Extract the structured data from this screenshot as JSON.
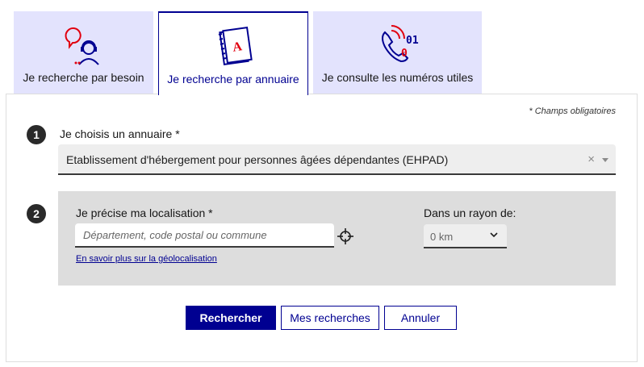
{
  "tabs": [
    {
      "label": "Je recherche par besoin",
      "icon": "person-speech-icon"
    },
    {
      "label": "Je recherche par annuaire",
      "icon": "address-book-icon"
    },
    {
      "label": "Je consulte les numéros utiles",
      "icon": "phone-numbers-icon"
    }
  ],
  "active_tab": 1,
  "form": {
    "required_note": "* Champs obligatoires",
    "step1": {
      "number": "1",
      "label": "Je choisis un annuaire *",
      "selected_value": "Etablissement d'hébergement pour personnes âgées dépendantes (EHPAD)",
      "clear_symbol": "×"
    },
    "step2": {
      "number": "2",
      "label": "Je précise ma localisation *",
      "input_placeholder": "Département, code postal ou commune",
      "input_value": "",
      "geo_link": "En savoir plus sur la géolocalisation",
      "radius_label": "Dans un rayon de:",
      "radius_value": "0 km"
    }
  },
  "buttons": {
    "search": "Rechercher",
    "my_searches": "Mes recherches",
    "cancel": "Annuler"
  },
  "colors": {
    "primary": "#000091",
    "tab_bg": "#e3e3fd",
    "accent_red": "#e1000f"
  }
}
